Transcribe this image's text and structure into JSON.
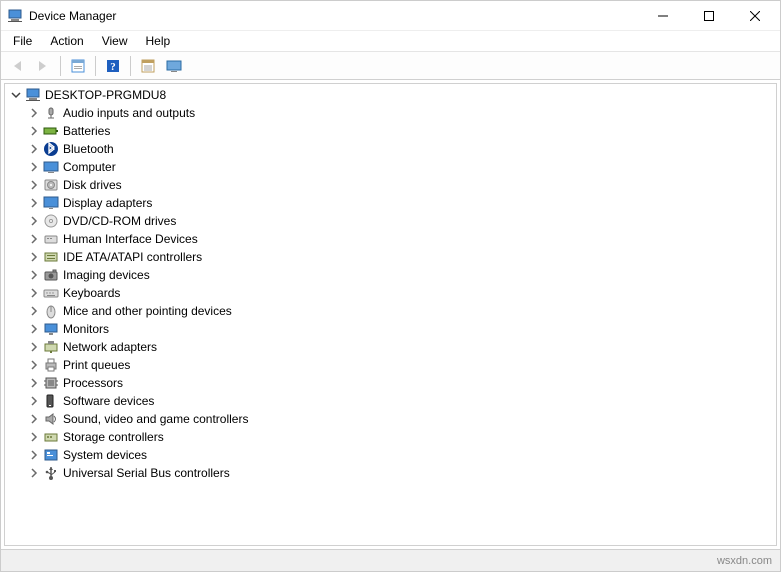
{
  "window": {
    "title": "Device Manager"
  },
  "menu": {
    "file": "File",
    "action": "Action",
    "view": "View",
    "help": "Help"
  },
  "tree": {
    "root": {
      "label": "DESKTOP-PRGMDU8"
    },
    "items": [
      {
        "label": "Audio inputs and outputs",
        "icon": "audio"
      },
      {
        "label": "Batteries",
        "icon": "battery"
      },
      {
        "label": "Bluetooth",
        "icon": "bluetooth"
      },
      {
        "label": "Computer",
        "icon": "computer"
      },
      {
        "label": "Disk drives",
        "icon": "disk"
      },
      {
        "label": "Display adapters",
        "icon": "display"
      },
      {
        "label": "DVD/CD-ROM drives",
        "icon": "dvd"
      },
      {
        "label": "Human Interface Devices",
        "icon": "hid"
      },
      {
        "label": "IDE ATA/ATAPI controllers",
        "icon": "ide"
      },
      {
        "label": "Imaging devices",
        "icon": "imaging"
      },
      {
        "label": "Keyboards",
        "icon": "keyboard"
      },
      {
        "label": "Mice and other pointing devices",
        "icon": "mouse"
      },
      {
        "label": "Monitors",
        "icon": "monitor"
      },
      {
        "label": "Network adapters",
        "icon": "network"
      },
      {
        "label": "Print queues",
        "icon": "printer"
      },
      {
        "label": "Processors",
        "icon": "cpu"
      },
      {
        "label": "Software devices",
        "icon": "software"
      },
      {
        "label": "Sound, video and game controllers",
        "icon": "sound"
      },
      {
        "label": "Storage controllers",
        "icon": "storage"
      },
      {
        "label": "System devices",
        "icon": "system"
      },
      {
        "label": "Universal Serial Bus controllers",
        "icon": "usb"
      }
    ]
  },
  "status": {
    "watermark": "wsxdn.com"
  }
}
